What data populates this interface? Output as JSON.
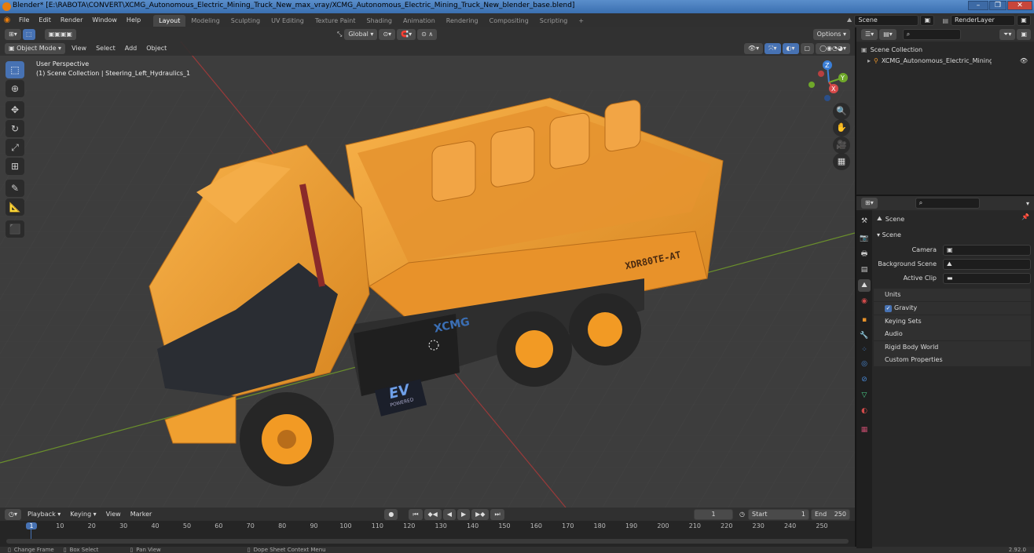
{
  "window": {
    "title": "Blender* [E:\\RABOTA\\CONVERT\\XCMG_Autonomous_Electric_Mining_Truck_New_max_vray/XCMG_Autonomous_Electric_Mining_Truck_New_blender_base.blend]",
    "minimize": "–",
    "maximize": "❐",
    "close": "✕"
  },
  "menu": {
    "items": [
      "File",
      "Edit",
      "Render",
      "Window",
      "Help"
    ],
    "workspaces": [
      "Layout",
      "Modeling",
      "Sculpting",
      "UV Editing",
      "Texture Paint",
      "Shading",
      "Animation",
      "Rendering",
      "Compositing",
      "Scripting"
    ],
    "active_workspace": "Layout",
    "add_workspace": "+",
    "scene": "Scene",
    "view_layer": "RenderLayer"
  },
  "viewport": {
    "transform_orientation": "Global",
    "options_label": "Options",
    "mode": "Object Mode",
    "menus": [
      "View",
      "Select",
      "Add",
      "Object"
    ],
    "overlay_title": "User Perspective",
    "overlay_subtitle": "(1) Scene Collection | Steering_Left_Hydraulics_1",
    "truck_text": "XDR80TE-AT",
    "brand_text": "XCMG",
    "ev_text": "EV",
    "ev_sub": "POWERED",
    "gizmo": {
      "z": "Z",
      "y": "Y",
      "x": "X"
    }
  },
  "timeline": {
    "menus": [
      "Playback",
      "Keying",
      "View",
      "Marker"
    ],
    "current_frame": "1",
    "start_label": "Start",
    "start": "1",
    "end_label": "End",
    "end": "250",
    "ticks": [
      "1",
      "10",
      "20",
      "30",
      "40",
      "50",
      "60",
      "70",
      "80",
      "90",
      "100",
      "110",
      "120",
      "130",
      "140",
      "150",
      "160",
      "170",
      "180",
      "190",
      "200",
      "210",
      "220",
      "230",
      "240",
      "250"
    ]
  },
  "status": {
    "items": [
      "Change Frame",
      "Box Select",
      "Pan View",
      "Dope Sheet Context Menu"
    ],
    "version": "2.92.0"
  },
  "outliner": {
    "root": "Scene Collection",
    "object": "XCMG_Autonomous_Electric_Mining_Truck_N"
  },
  "properties": {
    "context_title": "Scene",
    "section": "Scene",
    "camera_label": "Camera",
    "background_scene_label": "Background Scene",
    "active_clip_label": "Active Clip",
    "panels": [
      "Units",
      "Gravity",
      "Keying Sets",
      "Audio",
      "Rigid Body World",
      "Custom Properties"
    ],
    "gravity_checked": "✓"
  },
  "colors": {
    "accent": "#4772b3",
    "truck_orange": "#f0a030",
    "bg_viewport": "#3c3c3c"
  }
}
